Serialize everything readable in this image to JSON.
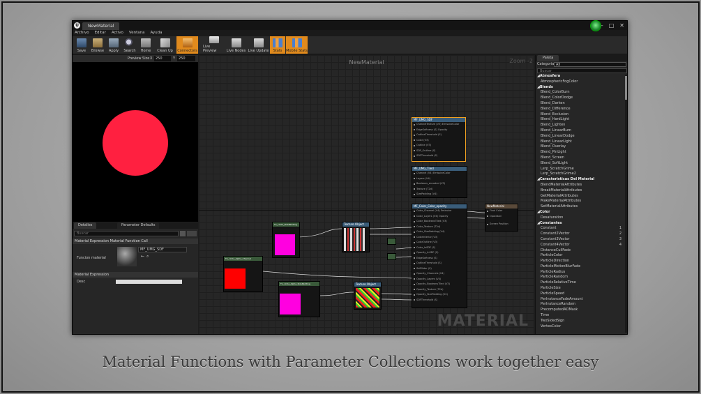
{
  "window": {
    "tab_title": "NewMaterial",
    "logo": "U",
    "controls": [
      "–",
      "□",
      "✕"
    ]
  },
  "menu": [
    "Archivo",
    "Editar",
    "Activo",
    "Ventana",
    "Ayuda"
  ],
  "toolbar": [
    {
      "label": "Save",
      "icon": "save-icon"
    },
    {
      "label": "Browse",
      "icon": "browse-icon"
    },
    {
      "label": "Apply",
      "icon": "apply-icon"
    },
    {
      "label": "Search",
      "icon": "search-icon"
    },
    {
      "label": "Home",
      "icon": "home-icon"
    },
    {
      "label": "Clean Up",
      "icon": "cleanup-icon"
    },
    {
      "label": "Connectors",
      "icon": "connectors-icon",
      "active": true
    },
    {
      "label": "Live Preview",
      "icon": "live-preview-icon"
    },
    {
      "label": "Live Nodes",
      "icon": "live-nodes-icon"
    },
    {
      "label": "Live Update",
      "icon": "live-update-icon"
    },
    {
      "label": "Stats",
      "icon": "stats-icon",
      "active": true
    },
    {
      "label": "Mobile Stats",
      "icon": "mobile-stats-icon",
      "active": true
    }
  ],
  "preview": {
    "size_label": "Preview Size",
    "x_label": "X",
    "x_value": "250",
    "y_label": "Y",
    "y_value": "250"
  },
  "details": {
    "tabs": [
      "Detalles",
      "Parameter Defaults"
    ],
    "search_placeholder": "Buscar",
    "section1": "Material Expression Material Function Call",
    "function_label": "Funcion material",
    "function_value": "MF_UMG_SDF",
    "section2": "Material Expression",
    "desc_label": "Desc"
  },
  "graph": {
    "title": "NewMaterial",
    "zoom": "Zoom -2",
    "watermark": "MATERIAL"
  },
  "nodes": {
    "sdf": {
      "title": "MF_UMG_SDF",
      "rows": [
        "ChannelTexture (V3) EmissiveColor",
        "EdgeSoftness (S) Opacity",
        "OutlineThreshold (S)",
        "Color (V3)",
        "Outline (V3)",
        "SDF_Outline (S)",
        "SDFThreshold (S)"
      ]
    },
    "tiled": {
      "title": "MF_UMG_Tiled",
      "rows": [
        "Channel (V4) EmissiveColor",
        "Layers (V4)",
        "Booleans_encoded (V3)",
        "Texture (T2d)",
        "SizePadding (V4)"
      ]
    },
    "opacity": {
      "title": "MF_Color_Color_opacity",
      "rows": [
        "Color_Channel (V4) Emissive",
        "Color_Layers (V4) Opacity",
        "Color_BooleansTiled (V3)",
        "Color_Texture (T2d)",
        "Color_SizePadding (V4)",
        "ColorInterior (V3)",
        "ColorOutline (V3)",
        "Color_InSDF (S)",
        "Opacity_InSDF (S)",
        "EdgeSoftness (S)",
        "OutlineThreshold (S)",
        "SdfSlider (S)",
        "Opacity_Channels (V4)",
        "Opacity_Layers (V4)",
        "Opacity_BooleansTiled (V3)",
        "Opacity_Texture (T2d)",
        "Opacity_SizePadding (V4)",
        "SDFThreshold (S)"
      ]
    },
    "output": {
      "title": "NewMaterial",
      "rows": [
        "Final Color",
        "Opacidad",
        "Screen Position"
      ]
    },
    "p1": {
      "title": "Tx_circle_SizePadding"
    },
    "p2": {
      "title": "Tx_circle_Alpha_Channel"
    },
    "p3": {
      "title": "Tx_circle_Alpha_SizePadding"
    },
    "tex1": {
      "title": "Texture Object"
    },
    "tex2": {
      "title": "Texture Object"
    }
  },
  "palette": {
    "tab": "Paleta",
    "category_label": "Categoria",
    "category_value": "All",
    "search_placeholder": "Buscar",
    "rows": [
      {
        "t": "Atmosfera",
        "cat": true
      },
      {
        "t": "AtmosphericFogColor"
      },
      {
        "t": "Blends",
        "cat": true
      },
      {
        "t": "Blend_ColorBurn"
      },
      {
        "t": "Blend_ColorDodge"
      },
      {
        "t": "Blend_Darken"
      },
      {
        "t": "Blend_Difference"
      },
      {
        "t": "Blend_Exclusion"
      },
      {
        "t": "Blend_HardLight"
      },
      {
        "t": "Blend_Lighten"
      },
      {
        "t": "Blend_LinearBurn"
      },
      {
        "t": "Blend_LinearDodge"
      },
      {
        "t": "Blend_LinearLight"
      },
      {
        "t": "Blend_Overlay"
      },
      {
        "t": "Blend_PinLight"
      },
      {
        "t": "Blend_Screen"
      },
      {
        "t": "Blend_SoftLight"
      },
      {
        "t": "Lerp_ScratchGrime"
      },
      {
        "t": "Lerp_ScratchGrime2"
      },
      {
        "t": "Caracteristicas Del Material",
        "cat": true
      },
      {
        "t": "BlendMaterialAttributes"
      },
      {
        "t": "BreakMaterialAttributes"
      },
      {
        "t": "GetMaterialAttributes"
      },
      {
        "t": "MakeMaterialAttributes"
      },
      {
        "t": "SetMaterialAttributes"
      },
      {
        "t": "Color",
        "cat": true
      },
      {
        "t": "Desaturation"
      },
      {
        "t": "Constantes",
        "cat": true
      },
      {
        "t": "Constant",
        "hk": "1"
      },
      {
        "t": "Constant2Vector",
        "hk": "2"
      },
      {
        "t": "Constant3Vector",
        "hk": "3"
      },
      {
        "t": "Constant4Vector",
        "hk": "4"
      },
      {
        "t": "DistanceCullFade"
      },
      {
        "t": "ParticleColor"
      },
      {
        "t": "ParticleDirection"
      },
      {
        "t": "ParticleMotionBlurFade"
      },
      {
        "t": "ParticleRadius"
      },
      {
        "t": "ParticleRandom"
      },
      {
        "t": "ParticleRelativeTime"
      },
      {
        "t": "ParticleSize"
      },
      {
        "t": "ParticleSpeed"
      },
      {
        "t": "PerInstanceFadeAmount"
      },
      {
        "t": "PerInstanceRandom"
      },
      {
        "t": "PrecomputedAOMask"
      },
      {
        "t": "Time"
      },
      {
        "t": "TwoSidedSign"
      },
      {
        "t": "VertexColor"
      }
    ]
  },
  "caption": "Material Functions with Parameter Collections work together easy",
  "colors": {
    "accent": "#e08a1d",
    "node_head_blue": "#3a5d7a",
    "node_head_green": "#3a5a3a",
    "node_select": "#f0a020"
  }
}
